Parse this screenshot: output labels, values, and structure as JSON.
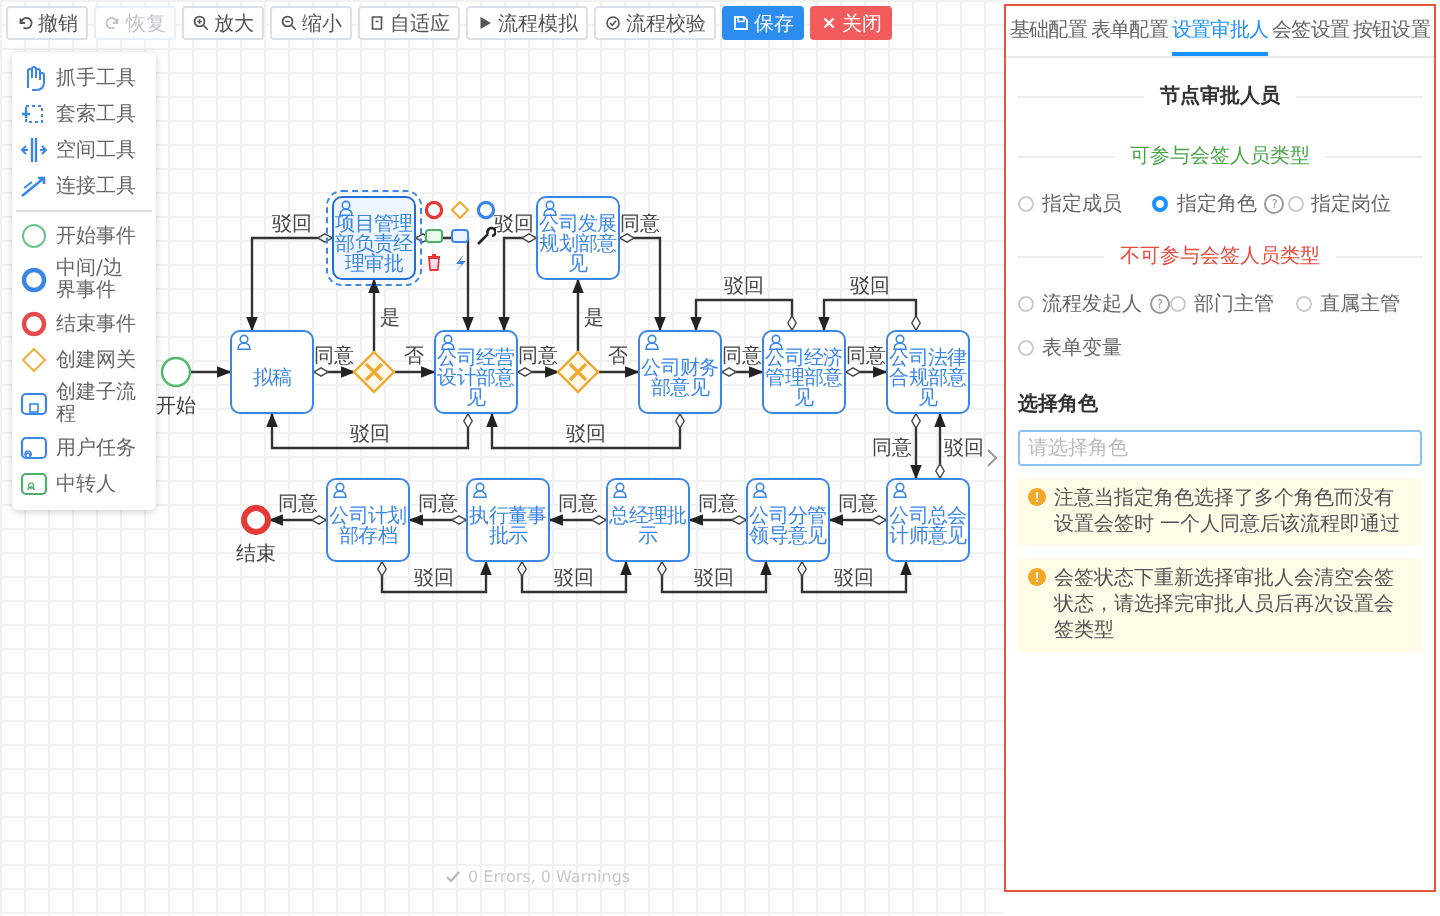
{
  "toolbar": [
    {
      "label": "撤销",
      "kind": "default",
      "disabled": false
    },
    {
      "label": "恢复",
      "kind": "default",
      "disabled": true
    },
    {
      "label": "放大",
      "kind": "default",
      "disabled": false
    },
    {
      "label": "缩小",
      "kind": "default",
      "disabled": false
    },
    {
      "label": "自适应",
      "kind": "default",
      "disabled": false
    },
    {
      "label": "流程模拟",
      "kind": "default",
      "disabled": false
    },
    {
      "label": "流程校验",
      "kind": "default",
      "disabled": false
    },
    {
      "label": "保存",
      "kind": "primary",
      "disabled": false
    },
    {
      "label": "关闭",
      "kind": "danger",
      "disabled": false
    }
  ],
  "palette": {
    "tools": [
      {
        "label": "抓手工具"
      },
      {
        "label": "套索工具"
      },
      {
        "label": "空间工具"
      },
      {
        "label": "连接工具"
      }
    ],
    "elements": [
      {
        "label": "开始事件"
      },
      {
        "label": "中间/边界事件"
      },
      {
        "label": "结束事件"
      },
      {
        "label": "创建网关"
      },
      {
        "label": "创建子流程"
      },
      {
        "label": "用户任务"
      },
      {
        "label": "中转人"
      }
    ]
  },
  "diagram": {
    "nodes": [
      {
        "kind": "task",
        "label": "项目管理部负责经理审批",
        "selected": true
      },
      {
        "kind": "task",
        "label": "公司发展规划部意见",
        "selected": false
      },
      {
        "kind": "start",
        "label": "开始",
        "selected": false
      },
      {
        "kind": "task",
        "label": "拟稿",
        "selected": false
      },
      {
        "kind": "gateway",
        "selected": false
      },
      {
        "kind": "task",
        "label": "公司经营设计部意见",
        "selected": false
      },
      {
        "kind": "gateway",
        "selected": false
      },
      {
        "kind": "task",
        "label": "公司财务部意见",
        "selected": false
      },
      {
        "kind": "task",
        "label": "公司经济管理部意见",
        "selected": false
      },
      {
        "kind": "task",
        "label": "公司法律合规部意见",
        "selected": false
      },
      {
        "kind": "end",
        "label": "结束",
        "selected": false
      },
      {
        "kind": "task",
        "label": "公司计划部存档",
        "selected": false
      },
      {
        "kind": "task",
        "label": "执行董事批示",
        "selected": false
      },
      {
        "kind": "task",
        "label": "总经理批示",
        "selected": false
      },
      {
        "kind": "task",
        "label": "公司分管领导意见",
        "selected": false
      },
      {
        "kind": "task",
        "label": "公司总会计师意见",
        "selected": false
      }
    ],
    "edges": [
      {
        "kind": "labeled",
        "label": "驳回"
      },
      {
        "kind": "plain"
      },
      {
        "kind": "labeled",
        "label": "驳回"
      },
      {
        "kind": "labeled",
        "label": "同意"
      },
      {
        "kind": "labeled",
        "label": "驳回"
      },
      {
        "kind": "labeled",
        "label": "驳回"
      },
      {
        "kind": "labeled",
        "label": "是"
      },
      {
        "kind": "labeled",
        "label": "是"
      },
      {
        "kind": "plain"
      },
      {
        "kind": "labeled",
        "label": "同意"
      },
      {
        "kind": "labeled",
        "label": "否"
      },
      {
        "kind": "labeled",
        "label": "同意"
      },
      {
        "kind": "labeled",
        "label": "否"
      },
      {
        "kind": "labeled",
        "label": "同意"
      },
      {
        "kind": "labeled",
        "label": "同意"
      },
      {
        "kind": "labeled",
        "label": "驳回"
      },
      {
        "kind": "labeled",
        "label": "驳回"
      },
      {
        "kind": "labeled",
        "label": "同意"
      },
      {
        "kind": "labeled",
        "label": "驳回"
      },
      {
        "kind": "labeled",
        "label": "同意"
      },
      {
        "kind": "labeled",
        "label": "同意"
      },
      {
        "kind": "labeled",
        "label": "同意"
      },
      {
        "kind": "labeled",
        "label": "同意"
      },
      {
        "kind": "labeled",
        "label": "同意"
      },
      {
        "kind": "labeled",
        "label": "驳回"
      },
      {
        "kind": "labeled",
        "label": "驳回"
      },
      {
        "kind": "labeled",
        "label": "驳回"
      },
      {
        "kind": "labeled",
        "label": "驳回"
      }
    ]
  },
  "status": "0 Errors, 0 Warnings",
  "panel": {
    "tabs": [
      {
        "label": "基础配置",
        "selected": false
      },
      {
        "label": "表单配置",
        "selected": false
      },
      {
        "label": "设置审批人",
        "selected": true
      },
      {
        "label": "会签设置",
        "selected": false
      },
      {
        "label": "按钮设置",
        "selected": false
      }
    ],
    "title": "节点审批人员",
    "sections": [
      {
        "kind": "allowed",
        "heading": "可参与会签人员类型",
        "options": [
          {
            "label": "指定成员",
            "selected": false
          },
          {
            "label": "指定角色",
            "selected": true,
            "help": "?"
          },
          {
            "label": "指定岗位",
            "selected": false
          }
        ]
      },
      {
        "kind": "blocked",
        "heading": "不可参与会签人员类型",
        "options": [
          {
            "label": "流程发起人",
            "selected": false,
            "help": "?"
          },
          {
            "label": "部门主管",
            "selected": false
          },
          {
            "label": "直属主管",
            "selected": false
          },
          {
            "label": "表单变量",
            "selected": false
          }
        ]
      }
    ],
    "field": {
      "label": "选择角色",
      "placeholder": "请选择角色"
    },
    "notices": [
      "注意当指定角色选择了多个角色而没有设置会签时 一个人同意后该流程即通过",
      "会签状态下重新选择审批人会清空会签状态，请选择完审批人员后再次设置会签类型"
    ]
  }
}
